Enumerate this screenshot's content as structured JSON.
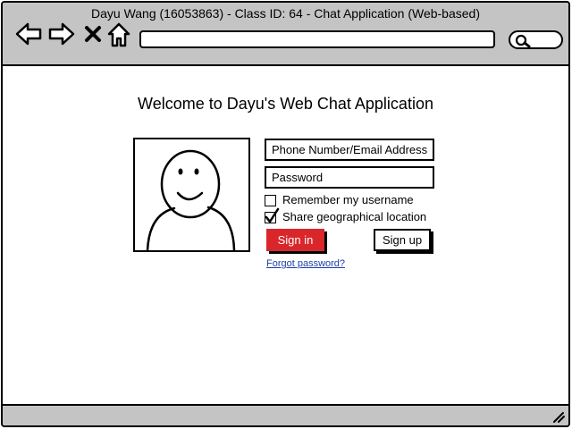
{
  "window": {
    "title": "Dayu Wang (16053863) - Class ID: 64 - Chat Application (Web-based)"
  },
  "toolbar": {
    "icons": [
      "back-arrow-icon",
      "forward-arrow-icon",
      "close-icon",
      "home-icon"
    ],
    "url_value": "",
    "search_icon": "search-icon"
  },
  "page": {
    "heading": "Welcome to Dayu's Web Chat Application",
    "avatar_icon": "avatar-placeholder-icon"
  },
  "login": {
    "phone_placeholder": "Phone Number/Email Address",
    "password_placeholder": "Password",
    "remember_label": "Remember my username",
    "remember_checked": false,
    "share_label": "Share geographical location",
    "share_checked": true,
    "signin_label": "Sign in",
    "signup_label": "Sign up",
    "forgot_label": "Forgot password?"
  },
  "colors": {
    "chrome": "#c4c4c4",
    "signin_button": "#d9262b",
    "link": "#1a3ea6"
  }
}
